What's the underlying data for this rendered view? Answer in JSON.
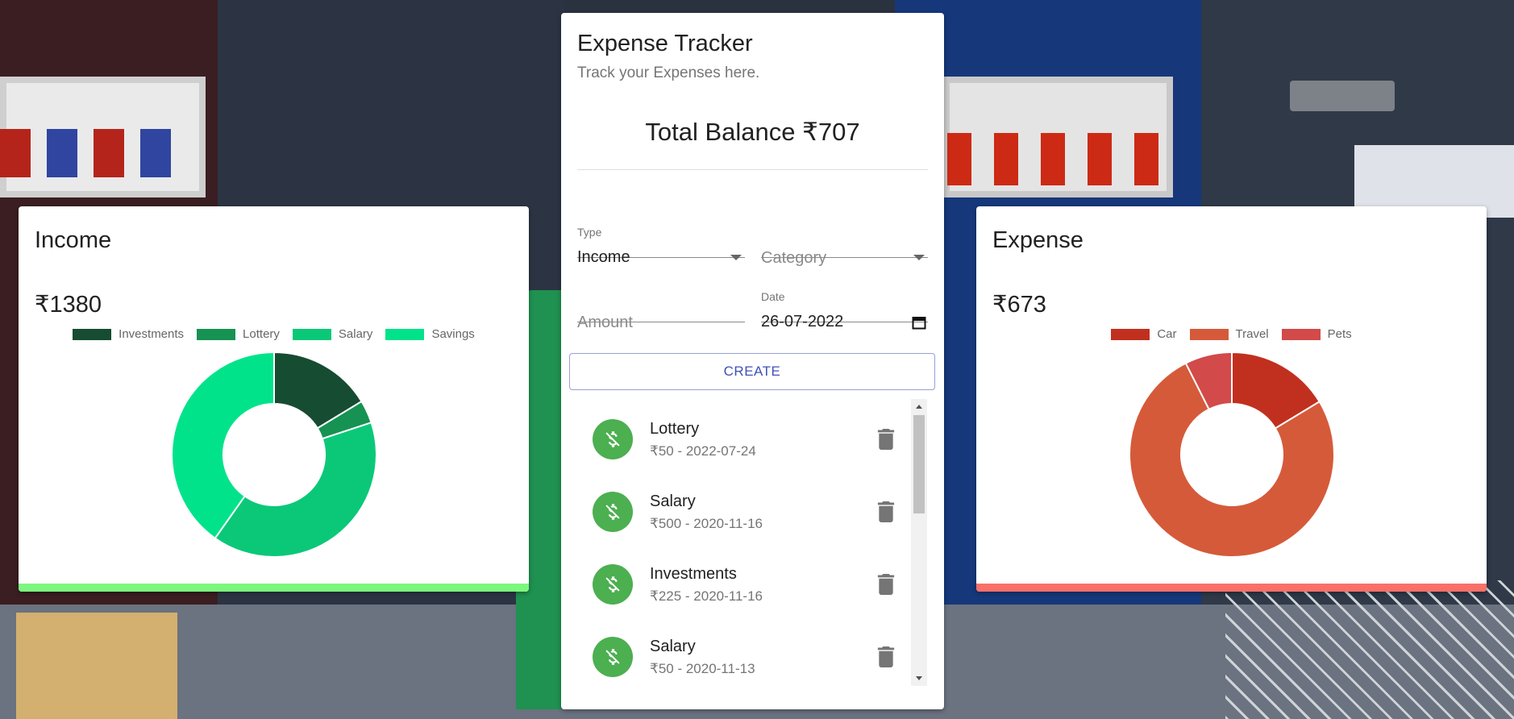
{
  "income_card": {
    "title": "Income",
    "amount": "₹1380",
    "bar_color": "#7cf77e",
    "chart_data": {
      "type": "pie",
      "categories": [
        "Investments",
        "Lottery",
        "Salary",
        "Savings"
      ],
      "values": [
        225,
        50,
        550,
        555
      ],
      "colors": [
        "#164c32",
        "#169253",
        "#0bc878",
        "#01e38a"
      ],
      "donut": true
    }
  },
  "expense_card": {
    "title": "Expense",
    "amount": "₹673",
    "bar_color": "#f87068",
    "chart_data": {
      "type": "pie",
      "categories": [
        "Car",
        "Travel",
        "Pets"
      ],
      "values": [
        110,
        513,
        50
      ],
      "colors": [
        "#c1301f",
        "#d55a3a",
        "#d24a4a"
      ],
      "donut": true
    }
  },
  "tracker": {
    "title": "Expense Tracker",
    "subtitle": "Track your Expenses here.",
    "balance": "Total Balance ₹707",
    "type_label": "Type",
    "type_value": "Income",
    "category_placeholder": "Category",
    "amount_placeholder": "Amount",
    "date_label": "Date",
    "date_value": "26-07-2022",
    "create_label": "CREATE",
    "transactions": [
      {
        "title": "Lottery",
        "detail": "₹50 - 2022-07-24"
      },
      {
        "title": "Salary",
        "detail": "₹500 - 2020-11-16"
      },
      {
        "title": "Investments",
        "detail": "₹225 - 2020-11-16"
      },
      {
        "title": "Salary",
        "detail": "₹50 - 2020-11-13"
      }
    ]
  },
  "icons": {
    "avatar": "money-off-icon",
    "delete": "trash-icon",
    "dropdown": "caret-down-icon",
    "calendar": "calendar-icon"
  }
}
